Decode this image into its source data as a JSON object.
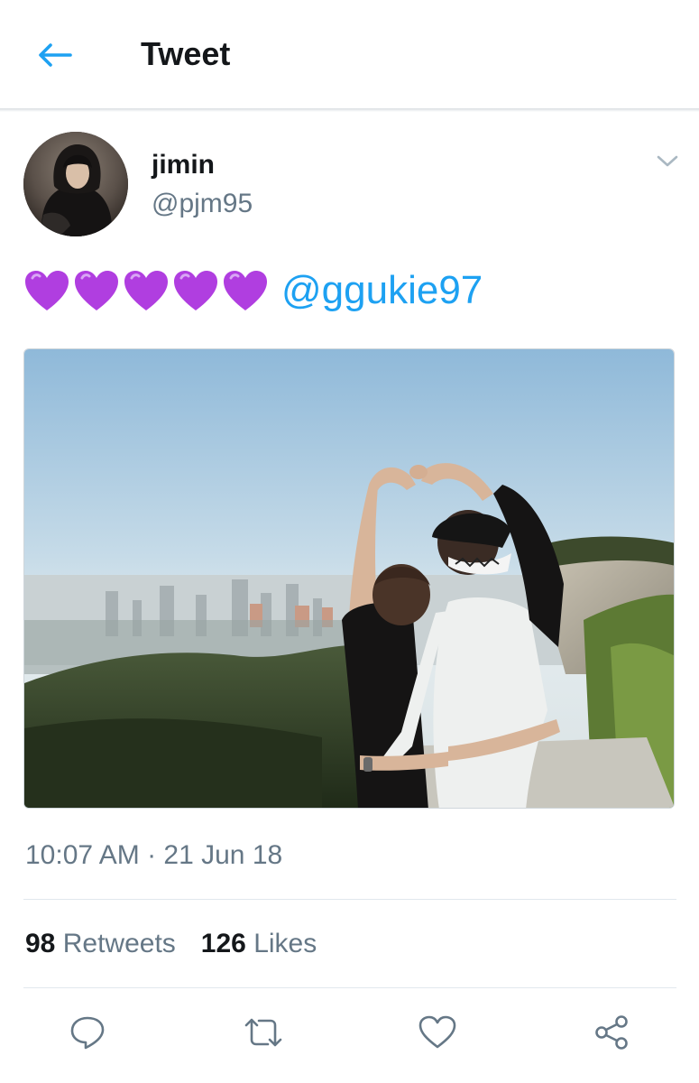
{
  "header": {
    "title": "Tweet",
    "back_icon": "back-arrow-icon",
    "accent_color": "#1da1f2"
  },
  "tweet": {
    "author_name": "jimin",
    "author_handle": "@pjm95",
    "hearts": [
      "💜",
      "💜",
      "💜",
      "💜",
      "💜"
    ],
    "mention": "@ggukie97",
    "timestamp": "10:07 AM · 21 Jun 18",
    "media_description_icon": "photo",
    "caret_icon": "chevron-down-icon"
  },
  "stats": {
    "retweets_count": "98",
    "retweets_label": "Retweets",
    "likes_count": "126",
    "likes_label": "Likes"
  },
  "actions": [
    "reply-icon",
    "retweet-icon",
    "like-icon",
    "share-icon"
  ],
  "colors": {
    "heart_purple": "#b03ee0",
    "secondary_text": "#657786",
    "divider": "#e1e8ed"
  }
}
